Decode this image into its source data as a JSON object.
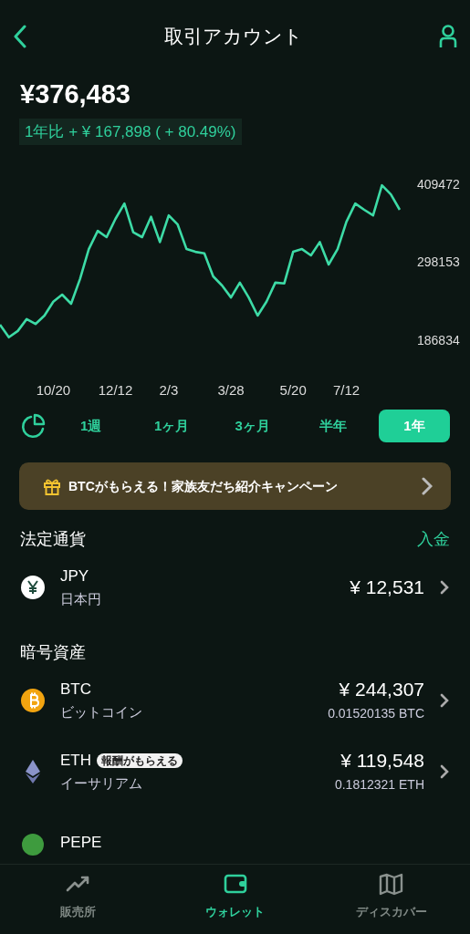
{
  "header": {
    "title": "取引アカウント"
  },
  "balance": {
    "total": "¥376,483",
    "change": "1年比 + ¥ 167,898 ( + 80.49%)"
  },
  "chart": {
    "chart_data": {
      "type": "line",
      "categories": [
        null,
        null,
        null,
        null,
        null,
        null,
        "10/20",
        null,
        null,
        null,
        null,
        null,
        null,
        "12/12",
        null,
        null,
        null,
        null,
        null,
        "2/3",
        null,
        null,
        null,
        null,
        null,
        null,
        "3/28",
        null,
        null,
        null,
        null,
        null,
        null,
        "5/20",
        null,
        null,
        null,
        null,
        null,
        "7/12",
        null,
        null,
        null,
        null,
        null,
        null
      ],
      "series": [
        {
          "color": "#3ddba6",
          "values": [
            207000,
            189000,
            198000,
            215000,
            208000,
            220000,
            240000,
            250000,
            237000,
            272000,
            315000,
            341000,
            332000,
            358000,
            380000,
            339000,
            332000,
            361000,
            325000,
            363000,
            350000,
            315000,
            311000,
            309000,
            276000,
            263000,
            246000,
            267000,
            246000,
            220000,
            240000,
            267000,
            266000,
            311000,
            315000,
            306000,
            325000,
            293000,
            315000,
            354000,
            380000,
            371000,
            363000,
            406000,
            393000,
            371000
          ]
        }
      ],
      "ylim": [
        186834,
        409472
      ],
      "yticks": [
        {
          "value": 409472,
          "label": "409472"
        },
        {
          "value": 298153,
          "label": "298153"
        },
        {
          "value": 186834,
          "label": "186834"
        }
      ]
    }
  },
  "ranges": [
    {
      "label": "1週",
      "selected": false
    },
    {
      "label": "1ヶ月",
      "selected": false
    },
    {
      "label": "3ヶ月",
      "selected": false
    },
    {
      "label": "半年",
      "selected": false
    },
    {
      "label": "1年",
      "selected": true
    }
  ],
  "banner": {
    "text": "BTCがもらえる！家族友だち紹介キャンペーン"
  },
  "fiat": {
    "title": "法定通貨",
    "action": "入金",
    "rows": [
      {
        "kind": "jpy",
        "symbol": "JPY",
        "name": "日本円",
        "value": "¥ 12,531"
      }
    ]
  },
  "crypto": {
    "title": "暗号資産",
    "rows": [
      {
        "kind": "btc",
        "symbol": "BTC",
        "name": "ビットコイン",
        "value": "¥ 244,307",
        "amount": "0.01520135 BTC"
      },
      {
        "kind": "eth",
        "symbol": "ETH",
        "tag": "報酬がもらえる",
        "name": "イーサリアム",
        "value": "¥ 119,548",
        "amount": "0.1812321 ETH"
      },
      {
        "kind": "pepe",
        "symbol": "PEPE"
      }
    ]
  },
  "bottom_nav": [
    {
      "kind": "trend",
      "label": "販売所",
      "selected": false
    },
    {
      "kind": "wallet",
      "label": "ウォレット",
      "selected": true
    },
    {
      "kind": "map",
      "label": "ディスカバー",
      "selected": false
    }
  ]
}
